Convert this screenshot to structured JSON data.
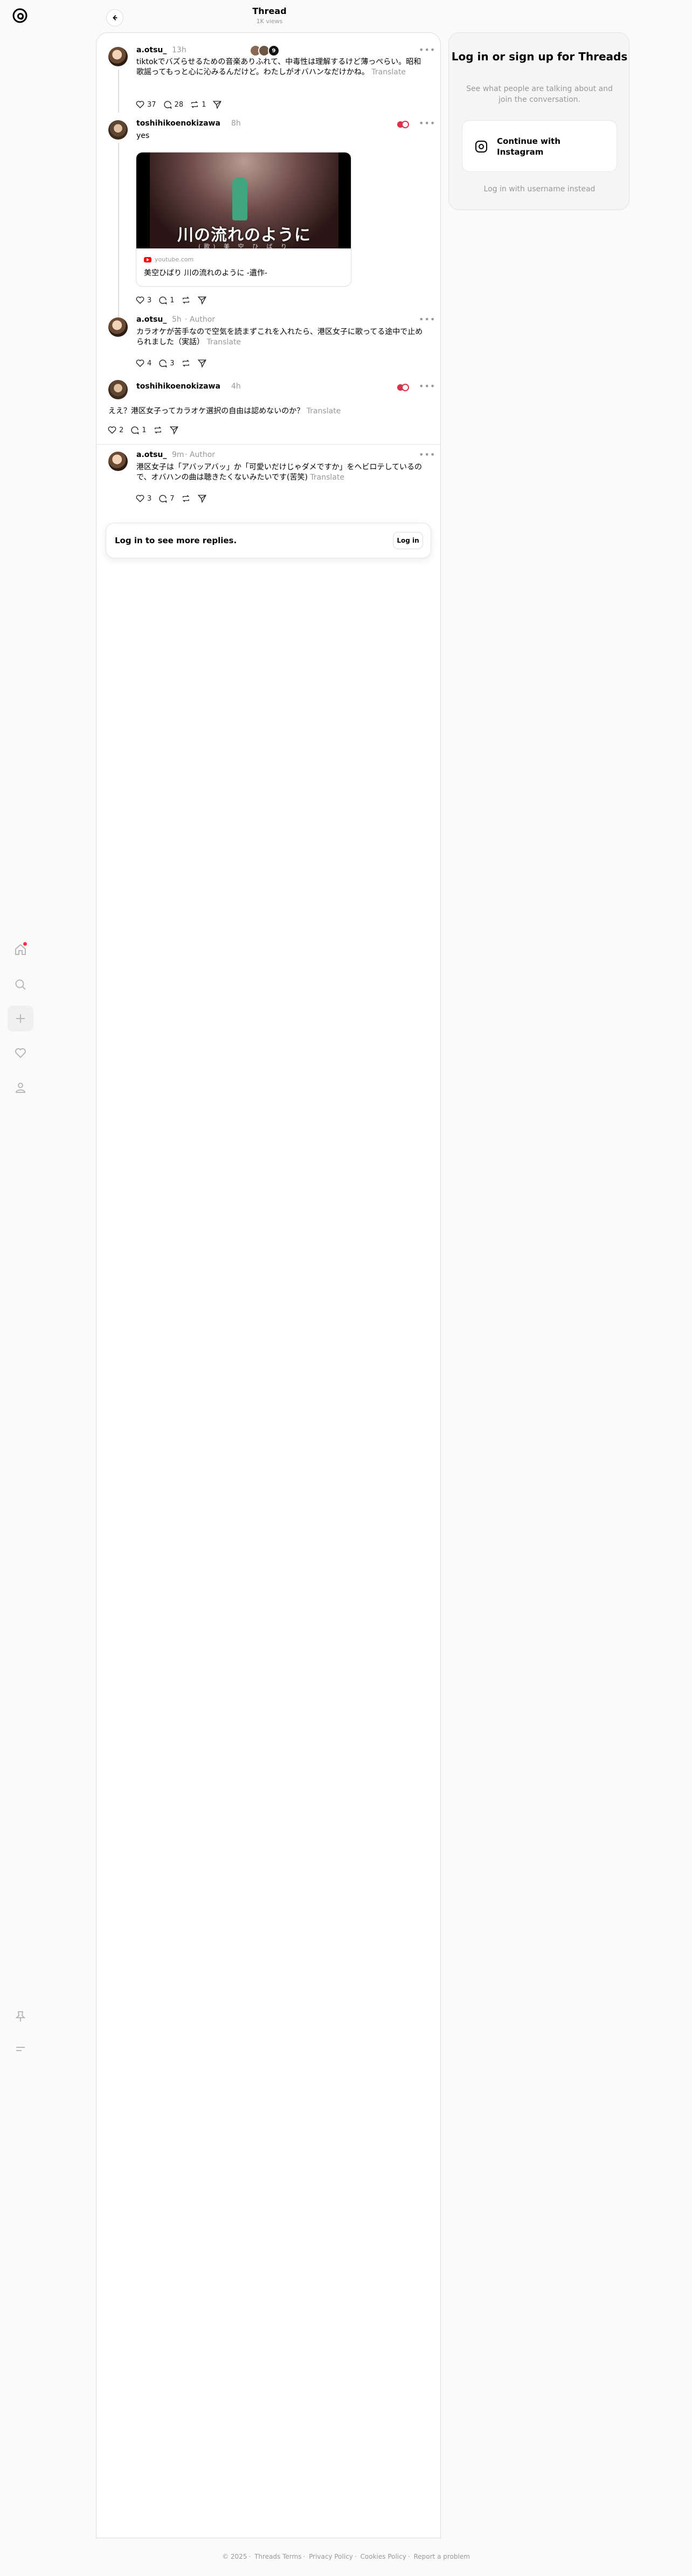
{
  "header": {
    "title": "Thread",
    "views": "1K views"
  },
  "sidebar": {
    "items": [
      {
        "name": "home"
      },
      {
        "name": "search"
      },
      {
        "name": "create"
      },
      {
        "name": "activity"
      },
      {
        "name": "profile"
      }
    ]
  },
  "posts": [
    {
      "username": "a.otsu_",
      "time": "13h",
      "author_tag": "",
      "text": "tiktokでバズらせるための音楽ありふれて、中毒性は理解するけど薄っぺらい。昭和歌謡ってもっと心に沁みるんだけど。わたしがオバハンなだけかね。",
      "translate": "Translate",
      "likes": "37",
      "replies": "28",
      "reposts": "1",
      "more_replies_count": "9"
    },
    {
      "username": "toshihikoenokizawa",
      "time": "8h",
      "text": "yes",
      "link_card": {
        "image_title": "川の流れのように",
        "image_sub": "(歌) 美 空 ひ ば り",
        "source": "youtube.com",
        "title": "美空ひばり 川の流れのように -遺作-"
      },
      "likes": "3",
      "replies": "1",
      "reposts": "",
      "shares": ""
    },
    {
      "username": "a.otsu_",
      "time": "5h",
      "author_tag": "Author",
      "text": "カラオケが苦手なので空気を読まずこれを入れたら、港区女子に歌ってる途中で止められました（実話）",
      "translate": "Translate",
      "likes": "4",
      "replies": "3"
    },
    {
      "username": "toshihikoenokizawa",
      "time": "4h",
      "text": "ええ？港区女子ってカラオケ選択の自由は認めないのか？",
      "translate": "Translate",
      "likes": "2",
      "replies": "1"
    },
    {
      "username": "a.otsu_",
      "time": "9m",
      "author_tag": "Author",
      "text": "港区女子は「アバッアバッ」か「可愛いだけじゃダメですか」をヘビロテしているので、オバハンの曲は聴きたくないみたいです(苦笑)",
      "translate": "Translate",
      "likes": "3",
      "replies": "7"
    }
  ],
  "more_box": {
    "text": "Log in to see more replies.",
    "button": "Log in"
  },
  "login_panel": {
    "title": "Log in or sign up for Threads",
    "subtitle": "See what people are talking about and join the conversation.",
    "button": "Continue with Instagram",
    "alt": "Log in with username instead"
  },
  "footer": {
    "items": [
      "© 2025",
      "Threads Terms",
      "Privacy Policy",
      "Cookies Policy",
      "Report a problem"
    ]
  }
}
